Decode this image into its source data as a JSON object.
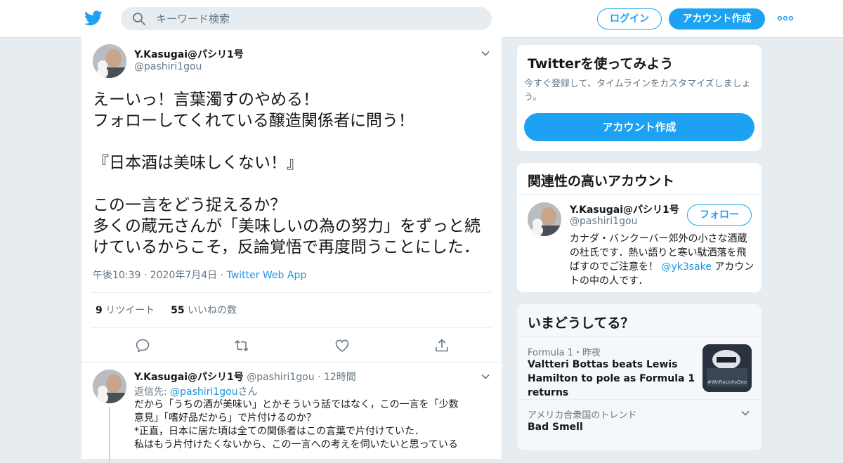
{
  "header": {
    "search_placeholder": "キーワード検索",
    "login_label": "ログイン",
    "signup_label": "アカウント作成"
  },
  "tweet": {
    "name": "Y.Kasugai@パシリ1号",
    "handle": "@pashiri1gou",
    "lines": [
      "えーいっ！言葉濁すのやめる！",
      "フォローしてくれている醸造関係者に問う！",
      "",
      "『日本酒は美味しくない！』",
      "",
      "この一言をどう捉えるか？",
      "多くの蔵元さんが「美味しいの為の努力」をずっと続",
      "けているからこそ，反論覚悟で再度問うことにした．"
    ],
    "time": "午後10:39",
    "date": "2020年7月4日",
    "source": "Twitter Web App",
    "retweet_count": "9",
    "retweet_label": "リツイート",
    "like_count": "55",
    "like_label": "いいねの数"
  },
  "reply": {
    "name": "Y.Kasugai@パシリ1号",
    "handle": "@pashiri1gou",
    "age": "12時間",
    "reply_to_prefix": "返信先: ",
    "reply_to_handle": "@pashiri1gou",
    "reply_to_suffix": "さん",
    "lines": [
      "だから「うちの酒が美味い」とかそういう話ではなく，この一言を「少数",
      "意見」「嗜好品だから」で片付けるのか？",
      "*正直，日本に居た頃は全ての関係者はこの言葉で片付けていた．",
      "私はもう片付けたくないから、この一言への考えを伺いたいと思っている"
    ]
  },
  "signup_card": {
    "title": "Twitterを使ってみよう",
    "desc": "今すぐ登録して、タイムラインをカスタマイズしましょう。",
    "button": "アカウント作成"
  },
  "related_card": {
    "title": "関連性の高いアカウント",
    "name": "Y.Kasugai@パシリ1号",
    "handle": "@pashiri1gou",
    "follow": "フォロー",
    "bio_before": "カナダ・バンクーバー郊外の小さな酒蔵の杜氏です．熱い語りと寒い駄洒落を飛ばすのでご注意を！ ",
    "bio_link": "@yk3sake",
    "bio_after": " アカウントの中の人です．"
  },
  "trends_card": {
    "title": "いまどうしてる？",
    "item1_context": "Formula 1・昨夜",
    "item1_title": "Valtteri Bottas beats Lewis Hamilton to pole as Formula 1 returns",
    "item1_thumb_text": "#WeRaceAsOne",
    "item2_context": "アメリカ合衆国のトレンド",
    "item2_title": "Bad Smell"
  },
  "colors": {
    "brand": "#1da1f2",
    "link": "#1b95e0",
    "secondary_text": "#657786",
    "background": "#e6ecf0"
  },
  "icons": [
    "twitter-logo-icon",
    "search-icon",
    "more-icon",
    "chevron-down-icon",
    "reply-icon",
    "retweet-icon",
    "like-icon",
    "share-icon"
  ]
}
